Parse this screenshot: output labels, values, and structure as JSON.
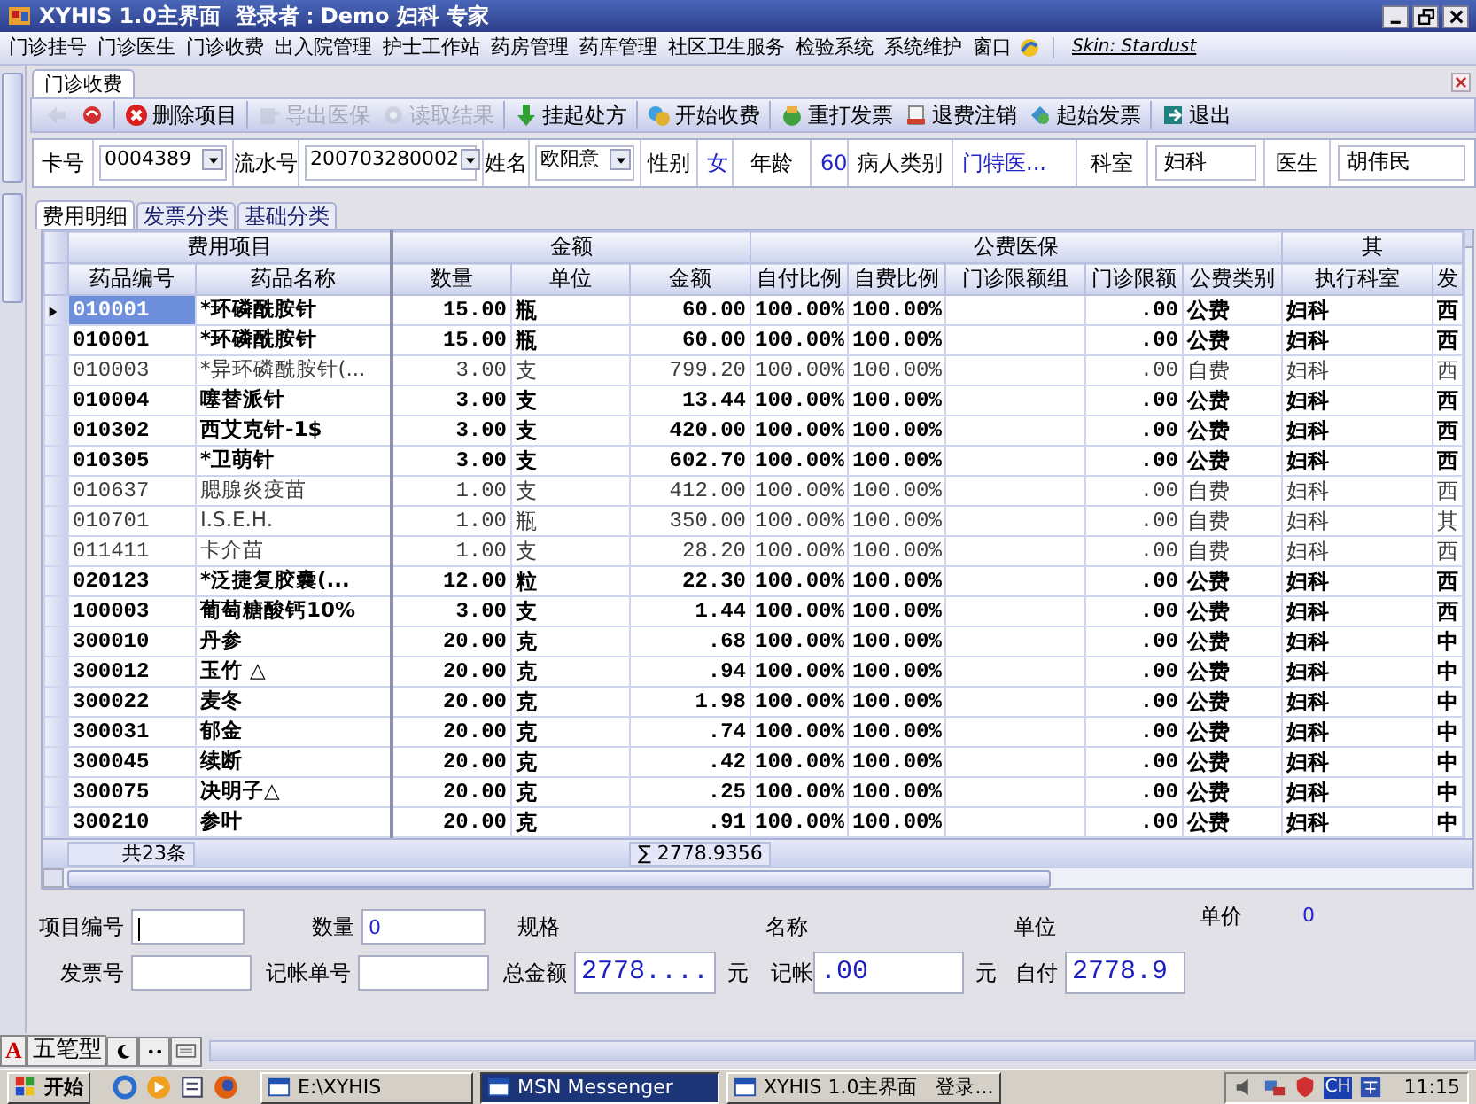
{
  "window": {
    "title": "XYHIS 1.0主界面  登录者：Demo 妇科 专家"
  },
  "menu": {
    "items": [
      "门诊挂号",
      "门诊医生",
      "门诊收费",
      "出入院管理",
      "护士工作站",
      "药房管理",
      "药库管理",
      "社区卫生服务",
      "检验系统",
      "系统维护",
      "窗口"
    ],
    "skin": "Skin: Stardust"
  },
  "document_tabs": [
    {
      "label": "门诊收费",
      "selected": true
    }
  ],
  "toolbar": [
    {
      "disabled": true
    },
    {
      "disabled": false
    },
    {
      "label": "删除项目",
      "disabled": false
    },
    {
      "label": "导出医保",
      "disabled": true
    },
    {
      "label": "读取结果",
      "disabled": true
    },
    {
      "label": "挂起处方",
      "disabled": false
    },
    {
      "label": "开始收费",
      "disabled": false
    },
    {
      "label": "重打发票",
      "disabled": false
    },
    {
      "label": "退费注销",
      "disabled": false
    },
    {
      "label": "起始发票",
      "disabled": false
    },
    {
      "label": "退出",
      "disabled": false
    }
  ],
  "patient": [
    {
      "kind": "label",
      "text": "卡号"
    },
    {
      "kind": "combo",
      "value": "0004389"
    },
    {
      "kind": "label",
      "text": "流水号"
    },
    {
      "kind": "combo",
      "value": "200703280002"
    },
    {
      "kind": "label",
      "text": "姓名"
    },
    {
      "kind": "combo",
      "value": "欧阳意"
    },
    {
      "kind": "label",
      "text": "性别"
    },
    {
      "kind": "value",
      "text": "女"
    },
    {
      "kind": "label",
      "text": "年龄"
    },
    {
      "kind": "value",
      "text": "60"
    },
    {
      "kind": "label",
      "text": "病人类别"
    },
    {
      "kind": "value",
      "text": "门特医..."
    },
    {
      "kind": "label",
      "text": "科室"
    },
    {
      "kind": "field",
      "value": "妇科"
    },
    {
      "kind": "label",
      "text": "医生"
    },
    {
      "kind": "field",
      "value": "胡伟民"
    }
  ],
  "detail_tabs": [
    {
      "label": "费用明细",
      "selected": true
    },
    {
      "label": "发票分类",
      "selected": false
    },
    {
      "label": "基础分类",
      "selected": false
    }
  ],
  "table": {
    "groups": [
      "费用项目",
      "金额",
      "公费医保",
      "其"
    ],
    "columns": [
      "药品编号",
      "药品名称",
      "数量",
      "单位",
      "金额",
      "自付比例",
      "自费比例",
      "门诊限额组",
      "门诊限额",
      "公费类别",
      "执行科室",
      "发"
    ],
    "rows": [
      {
        "selected": true,
        "bold": true,
        "code": "010001",
        "name": "*环磷酰胺针",
        "quantity": "15.00",
        "unit": "瓶",
        "amount": "60.00",
        "self_pay_ratio": "100.00%",
        "self_fee_ratio": "100.00%",
        "outpatient_limit": ".00",
        "fee_category": "公费",
        "department": "妇科",
        "column_12": "西"
      },
      {
        "selected": false,
        "bold": true,
        "code": "010001",
        "name": "*环磷酰胺针",
        "quantity": "15.00",
        "unit": "瓶",
        "amount": "60.00",
        "self_pay_ratio": "100.00%",
        "self_fee_ratio": "100.00%",
        "outpatient_limit": ".00",
        "fee_category": "公费",
        "department": "妇科",
        "column_12": "西"
      },
      {
        "selected": false,
        "bold": false,
        "code": "010003",
        "name": "*异环磷酰胺针(...",
        "quantity": "3.00",
        "unit": "支",
        "amount": "799.20",
        "self_pay_ratio": "100.00%",
        "self_fee_ratio": "100.00%",
        "outpatient_limit": ".00",
        "fee_category": "自费",
        "department": "妇科",
        "column_12": "西"
      },
      {
        "selected": false,
        "bold": true,
        "code": "010004",
        "name": "噻替派针",
        "quantity": "3.00",
        "unit": "支",
        "amount": "13.44",
        "self_pay_ratio": "100.00%",
        "self_fee_ratio": "100.00%",
        "outpatient_limit": ".00",
        "fee_category": "公费",
        "department": "妇科",
        "column_12": "西"
      },
      {
        "selected": false,
        "bold": true,
        "code": "010302",
        "name": "西艾克针-1$",
        "quantity": "3.00",
        "unit": "支",
        "amount": "420.00",
        "self_pay_ratio": "100.00%",
        "self_fee_ratio": "100.00%",
        "outpatient_limit": ".00",
        "fee_category": "公费",
        "department": "妇科",
        "column_12": "西"
      },
      {
        "selected": false,
        "bold": true,
        "code": "010305",
        "name": "*卫萌针",
        "quantity": "3.00",
        "unit": "支",
        "amount": "602.70",
        "self_pay_ratio": "100.00%",
        "self_fee_ratio": "100.00%",
        "outpatient_limit": ".00",
        "fee_category": "公费",
        "department": "妇科",
        "column_12": "西"
      },
      {
        "selected": false,
        "bold": false,
        "code": "010637",
        "name": "腮腺炎疫苗",
        "quantity": "1.00",
        "unit": "支",
        "amount": "412.00",
        "self_pay_ratio": "100.00%",
        "self_fee_ratio": "100.00%",
        "outpatient_limit": ".00",
        "fee_category": "自费",
        "department": "妇科",
        "column_12": "西"
      },
      {
        "selected": false,
        "bold": false,
        "code": "010701",
        "name": "I.S.E.H.",
        "quantity": "1.00",
        "unit": "瓶",
        "amount": "350.00",
        "self_pay_ratio": "100.00%",
        "self_fee_ratio": "100.00%",
        "outpatient_limit": ".00",
        "fee_category": "自费",
        "department": "妇科",
        "column_12": "其"
      },
      {
        "selected": false,
        "bold": false,
        "code": "011411",
        "name": "卡介苗",
        "quantity": "1.00",
        "unit": "支",
        "amount": "28.20",
        "self_pay_ratio": "100.00%",
        "self_fee_ratio": "100.00%",
        "outpatient_limit": ".00",
        "fee_category": "自费",
        "department": "妇科",
        "column_12": "西"
      },
      {
        "selected": false,
        "bold": true,
        "code": "020123",
        "name": "*泛捷复胶囊(...",
        "quantity": "12.00",
        "unit": "粒",
        "amount": "22.30",
        "self_pay_ratio": "100.00%",
        "self_fee_ratio": "100.00%",
        "outpatient_limit": ".00",
        "fee_category": "公费",
        "department": "妇科",
        "column_12": "西"
      },
      {
        "selected": false,
        "bold": true,
        "code": "100003",
        "name": "葡萄糖酸钙10%",
        "quantity": "3.00",
        "unit": "支",
        "amount": "1.44",
        "self_pay_ratio": "100.00%",
        "self_fee_ratio": "100.00%",
        "outpatient_limit": ".00",
        "fee_category": "公费",
        "department": "妇科",
        "column_12": "西"
      },
      {
        "selected": false,
        "bold": true,
        "code": "300010",
        "name": "丹参",
        "quantity": "20.00",
        "unit": "克",
        "amount": ".68",
        "self_pay_ratio": "100.00%",
        "self_fee_ratio": "100.00%",
        "outpatient_limit": ".00",
        "fee_category": "公费",
        "department": "妇科",
        "column_12": "中"
      },
      {
        "selected": false,
        "bold": true,
        "code": "300012",
        "name": "玉竹   △",
        "quantity": "20.00",
        "unit": "克",
        "amount": ".94",
        "self_pay_ratio": "100.00%",
        "self_fee_ratio": "100.00%",
        "outpatient_limit": ".00",
        "fee_category": "公费",
        "department": "妇科",
        "column_12": "中"
      },
      {
        "selected": false,
        "bold": true,
        "code": "300022",
        "name": "麦冬",
        "quantity": "20.00",
        "unit": "克",
        "amount": "1.98",
        "self_pay_ratio": "100.00%",
        "self_fee_ratio": "100.00%",
        "outpatient_limit": ".00",
        "fee_category": "公费",
        "department": "妇科",
        "column_12": "中"
      },
      {
        "selected": false,
        "bold": true,
        "code": "300031",
        "name": "郁金",
        "quantity": "20.00",
        "unit": "克",
        "amount": ".74",
        "self_pay_ratio": "100.00%",
        "self_fee_ratio": "100.00%",
        "outpatient_limit": ".00",
        "fee_category": "公费",
        "department": "妇科",
        "column_12": "中"
      },
      {
        "selected": false,
        "bold": true,
        "code": "300045",
        "name": "续断",
        "quantity": "20.00",
        "unit": "克",
        "amount": ".42",
        "self_pay_ratio": "100.00%",
        "self_fee_ratio": "100.00%",
        "outpatient_limit": ".00",
        "fee_category": "公费",
        "department": "妇科",
        "column_12": "中"
      },
      {
        "selected": false,
        "bold": true,
        "code": "300075",
        "name": "决明子△",
        "quantity": "20.00",
        "unit": "克",
        "amount": ".25",
        "self_pay_ratio": "100.00%",
        "self_fee_ratio": "100.00%",
        "outpatient_limit": ".00",
        "fee_category": "公费",
        "department": "妇科",
        "column_12": "中"
      },
      {
        "selected": false,
        "bold": true,
        "code": "300210",
        "name": "参叶",
        "quantity": "20.00",
        "unit": "克",
        "amount": ".91",
        "self_pay_ratio": "100.00%",
        "self_fee_ratio": "100.00%",
        "outpatient_limit": ".00",
        "fee_category": "公费",
        "department": "妇科",
        "column_12": "中"
      }
    ],
    "footer": {
      "count": "共23条",
      "sum": "∑ 2778.9356"
    }
  },
  "form": {
    "item_fields": [
      {
        "label": "项目编号",
        "input": {
          "kind": "field",
          "focused": true
        }
      },
      {
        "label": "数量",
        "input": {
          "kind": "field",
          "value": "0",
          "focused": false
        }
      },
      {
        "label": "规格"
      },
      {
        "label": "名称"
      },
      {
        "label": "单位"
      },
      {
        "label": "单价",
        "value": "0"
      }
    ],
    "charge_fields": [
      {
        "label": "发票号",
        "input": {
          "kind": "field",
          "focused": false
        }
      },
      {
        "label": "记帐单号",
        "input": {
          "kind": "field",
          "focused": false
        }
      },
      {
        "label": "总金额",
        "input": {
          "kind": "amount",
          "value": "2778...."
        },
        "suffix": "元"
      },
      {
        "label": "记帐",
        "input": {
          "kind": "amount",
          "value": ".00"
        },
        "suffix": "元"
      },
      {
        "label": "自付",
        "input": {
          "kind": "amount",
          "value": "2778.9"
        }
      }
    ]
  },
  "ime": {
    "letter": "A",
    "mode": "五笔型"
  },
  "taskbar": {
    "start": "开始",
    "tasks": [
      {
        "label": "E:\\XYHIS",
        "selected": false
      },
      {
        "label": "MSN Messenger",
        "selected": true
      },
      {
        "label": "XYHIS 1.0主界面   登录...",
        "selected": false
      }
    ],
    "language": "CH",
    "clock": "11:15"
  }
}
